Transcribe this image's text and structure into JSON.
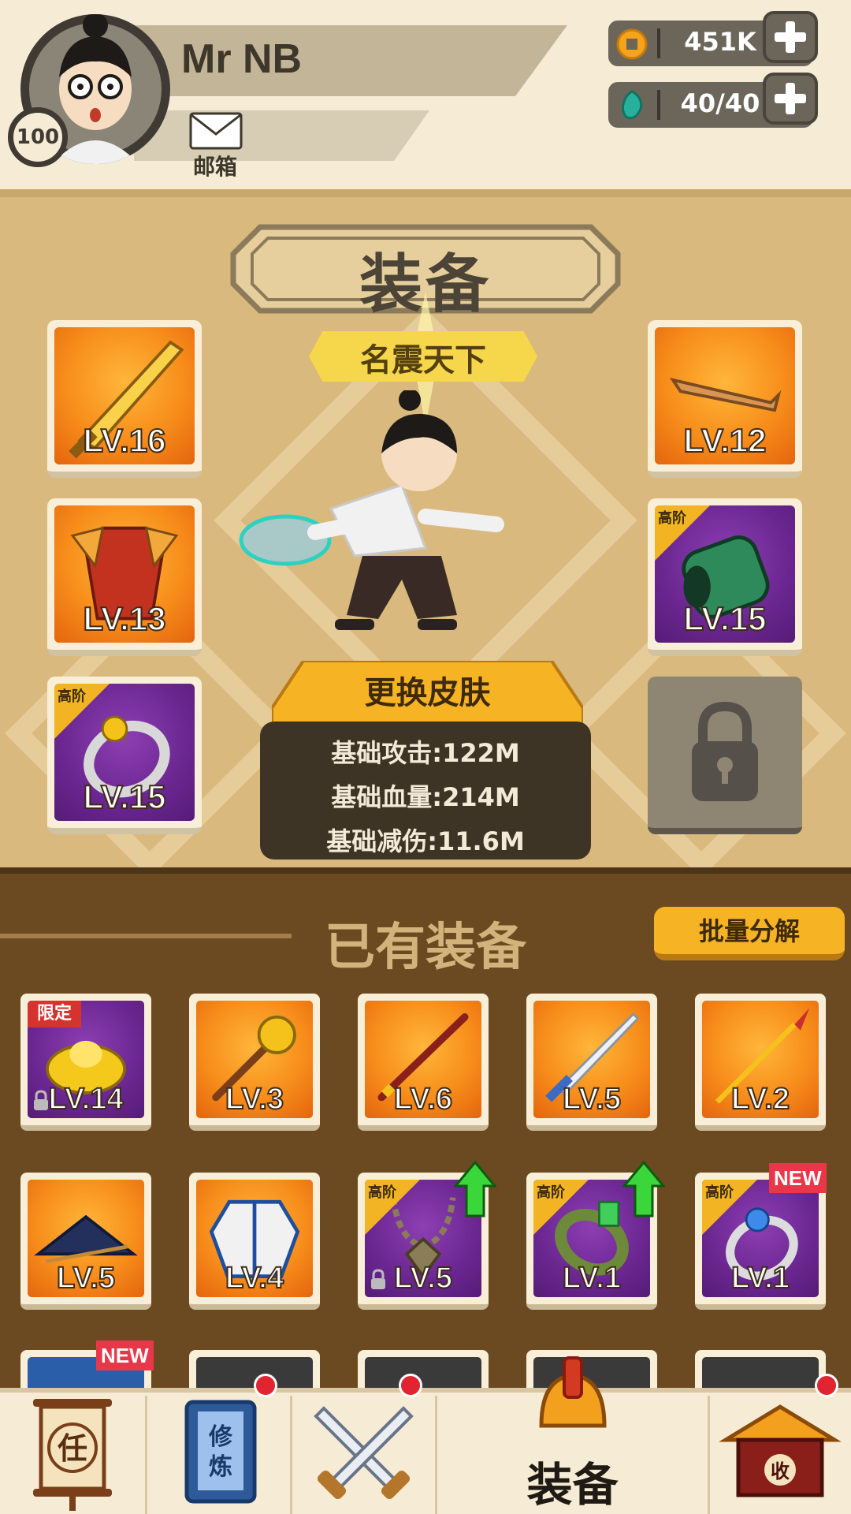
{
  "player": {
    "name": "Mr NB",
    "level": "100",
    "mail_label": "邮箱"
  },
  "resources": {
    "gold": "451K",
    "energy": "40/40"
  },
  "equipment": {
    "title": "装备",
    "subtitle": "名震天下",
    "change_skin_label": "更换皮肤",
    "equipped_slots": [
      {
        "item": "golden-sword",
        "level": "LV.16",
        "rarity": "orange"
      },
      {
        "item": "red-armor",
        "level": "LV.13",
        "rarity": "orange"
      },
      {
        "item": "silver-ring",
        "level": "LV.15",
        "rarity": "purple",
        "tag": "高阶"
      },
      {
        "item": "bronze-dragon-blade",
        "level": "LV.12",
        "rarity": "orange"
      },
      {
        "item": "green-gauntlet",
        "level": "LV.15",
        "rarity": "purple",
        "tag": "高阶"
      }
    ],
    "stats": [
      "基础攻击:122M",
      "基础血量:214M",
      "基础减伤:11.6M"
    ]
  },
  "owned": {
    "title": "已有装备",
    "batch_decompose_label": "批量分解",
    "items": [
      {
        "item": "gold-ingot",
        "level": "LV.14",
        "rarity": "purple",
        "tag": "限定",
        "locked": true
      },
      {
        "item": "golden-mace",
        "level": "LV.3",
        "rarity": "orange"
      },
      {
        "item": "red-staff",
        "level": "LV.6",
        "rarity": "orange"
      },
      {
        "item": "steel-sword",
        "level": "LV.5",
        "rarity": "orange"
      },
      {
        "item": "golden-spear",
        "level": "LV.2",
        "rarity": "orange"
      },
      {
        "item": "blue-hat",
        "level": "LV.5",
        "rarity": "orange"
      },
      {
        "item": "blue-robe",
        "level": "LV.4",
        "rarity": "orange"
      },
      {
        "item": "jade-necklace",
        "level": "LV.5",
        "rarity": "purple",
        "tag": "高阶",
        "locked": true,
        "upgrade": true
      },
      {
        "item": "green-bracelet",
        "level": "LV.1",
        "rarity": "purple",
        "tag": "高阶",
        "upgrade": true
      },
      {
        "item": "blue-ring",
        "level": "LV.1",
        "rarity": "purple",
        "tag": "高阶",
        "badge": "NEW"
      }
    ],
    "partial_row_badge": "NEW"
  },
  "nav": {
    "tasks_glyph": "任",
    "cultivate_glyph_1": "修",
    "cultivate_glyph_2": "炼",
    "equipment_label": "装备",
    "shop_glyph": "收"
  },
  "colors": {
    "panel": "#d9b97d",
    "owned_bg": "#6b4a22",
    "orange_rarity": "#f78d1b",
    "purple_rarity": "#6a2690",
    "accent_yellow": "#f6b324",
    "notification_red": "#e02430"
  }
}
